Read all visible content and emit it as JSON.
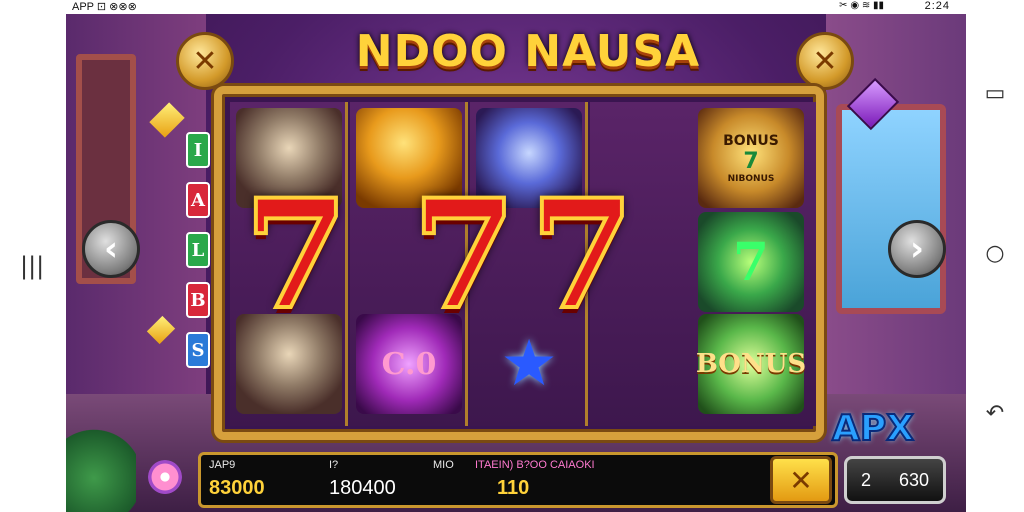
{
  "status_bar": {
    "left_text": "APP",
    "icons_left": "⊡ ⊗⊗⊗",
    "right_time": "2:24",
    "icons_right": "✂ ◉ ≋ ▮▮"
  },
  "game": {
    "title": "NDOO NAUSA",
    "side_letters": [
      "I",
      "A",
      "L",
      "B",
      "S"
    ],
    "reels": {
      "reel1_top": "",
      "reel2_top": "",
      "reel3_top": "",
      "reel4_top_badge": "BONUS",
      "reel4_top_badge_sub": "NIBONUS",
      "reel2_bottom_text": "C.0",
      "reel5_bottom_text": "BONUS"
    },
    "sevens": "7",
    "logo": "APX"
  },
  "info_panel": {
    "col1_label": "JAP9",
    "col1_value": "83000",
    "col2_label": "I?",
    "col2_value": "180400",
    "col3_label": "MIO",
    "col3_value": "110",
    "col4_label": "ITAEIN) B?OO CAIAOKI"
  },
  "bet": {
    "prefix": "2",
    "value": "630"
  },
  "colors": {
    "title_gold": "#ffd23a",
    "seven_red": "#e21a1a",
    "frame_gold": "#d6a03c",
    "panel_bg": "#0b0b0b"
  },
  "icons": {
    "corner_close": "close-icon",
    "arrow_left": "chevron-left-icon",
    "arrow_right": "chevron-right-icon",
    "nav_back": "back-icon",
    "nav_home": "home-icon",
    "nav_recents": "recents-icon",
    "nav_menu": "menu-icon"
  }
}
